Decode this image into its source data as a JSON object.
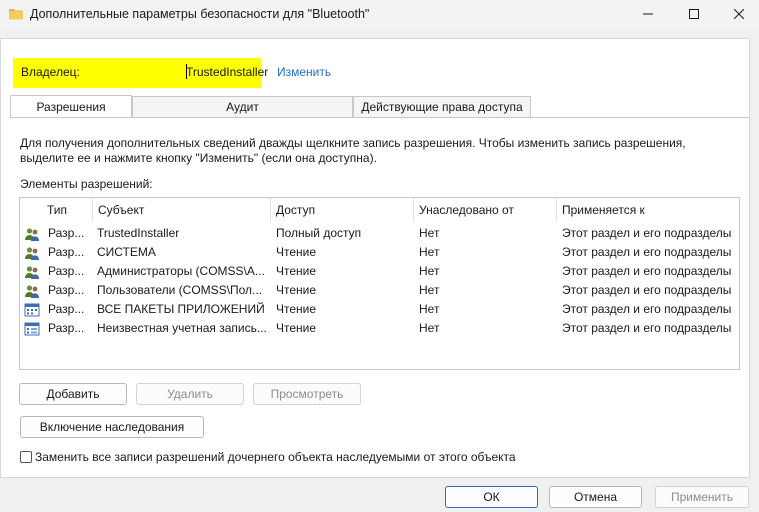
{
  "window": {
    "title": "Дополнительные параметры безопасности  для \"Bluetooth\"",
    "icons": {
      "app": "folder-icon",
      "minimize": "minimize-icon",
      "maximize": "maximize-icon",
      "close": "close-icon"
    }
  },
  "owner": {
    "label": "Владелец:",
    "value": "TrustedInstaller",
    "change_link": "Изменить",
    "highlight_color": "#ffff00"
  },
  "tabs": [
    {
      "label": "Разрешения",
      "selected": true
    },
    {
      "label": "Аудит",
      "selected": false
    },
    {
      "label": "Действующие права доступа",
      "selected": false
    }
  ],
  "description": "Для получения дополнительных сведений дважды щелкните запись разрешения. Чтобы изменить запись разрешения, выделите ее и нажмите кнопку \"Изменить\" (если она доступна).",
  "permissions": {
    "label": "Элементы разрешений:",
    "columns": [
      "Тип",
      "Субъект",
      "Доступ",
      "Унаследовано от",
      "Применяется к"
    ],
    "rows": [
      {
        "icon": "users-group-icon",
        "type": "Разр...",
        "subject": "TrustedInstaller",
        "access": "Полный доступ",
        "inherited": "Нет",
        "applies": "Этот раздел и его подразделы"
      },
      {
        "icon": "users-group-icon",
        "type": "Разр...",
        "subject": "СИСТЕМА",
        "access": "Чтение",
        "inherited": "Нет",
        "applies": "Этот раздел и его подразделы"
      },
      {
        "icon": "users-group-icon",
        "type": "Разр...",
        "subject": "Администраторы (COMSS\\А...",
        "access": "Чтение",
        "inherited": "Нет",
        "applies": "Этот раздел и его подразделы"
      },
      {
        "icon": "users-group-icon",
        "type": "Разр...",
        "subject": "Пользователи (COMSS\\Пол...",
        "access": "Чтение",
        "inherited": "Нет",
        "applies": "Этот раздел и его подразделы"
      },
      {
        "icon": "app-packages-icon",
        "type": "Разр...",
        "subject": "ВСЕ ПАКЕТЫ ПРИЛОЖЕНИЙ",
        "access": "Чтение",
        "inherited": "Нет",
        "applies": "Этот раздел и его подразделы"
      },
      {
        "icon": "unknown-account-icon",
        "type": "Разр...",
        "subject": "Неизвестная учетная запись...",
        "access": "Чтение",
        "inherited": "Нет",
        "applies": "Этот раздел и его подразделы"
      }
    ]
  },
  "buttons": {
    "add": "Добавить",
    "remove": "Удалить",
    "view": "Просмотреть",
    "enable_inheritance": "Включение наследования"
  },
  "replace_checkbox": {
    "label": "Заменить все записи разрешений дочернего объекта наследуемыми от этого объекта",
    "checked": false
  },
  "footer": {
    "ok": "ОК",
    "cancel": "Отмена",
    "apply": "Применить"
  }
}
